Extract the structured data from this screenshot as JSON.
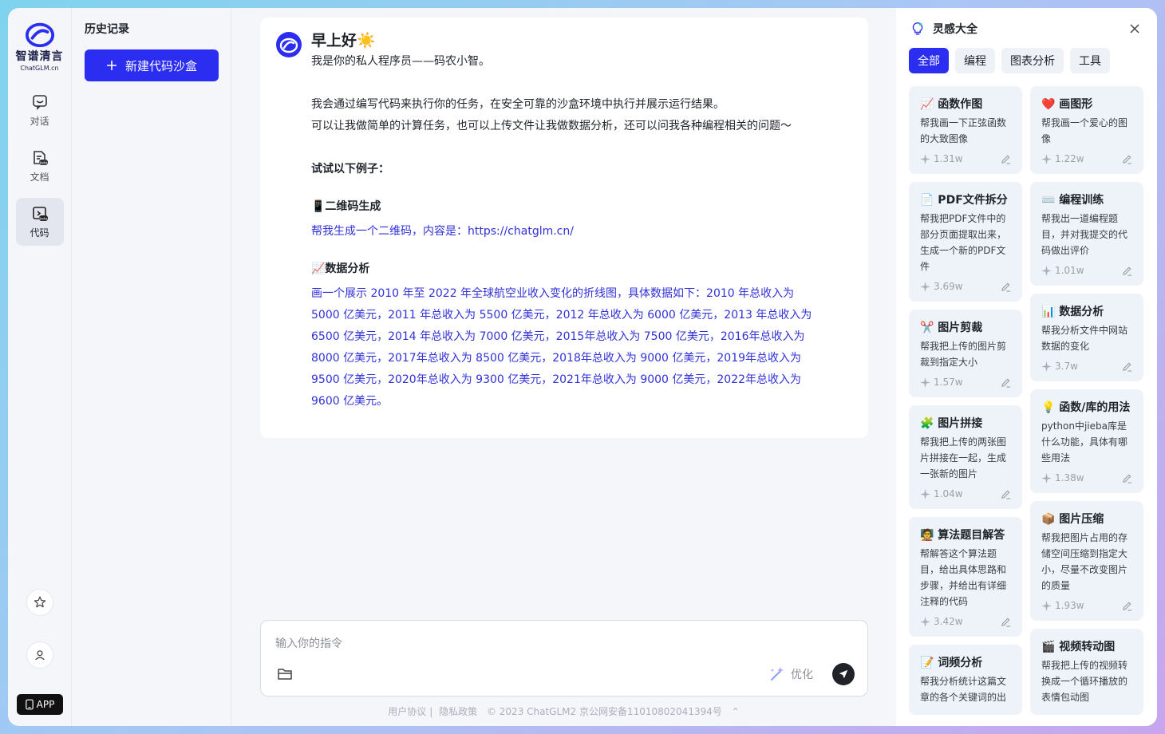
{
  "brand": {
    "name_cn": "智谱清言",
    "name_en": "ChatGLM.cn"
  },
  "rail": {
    "items": [
      {
        "label": "对话",
        "icon": "chat-icon"
      },
      {
        "label": "文档",
        "icon": "document-beta-icon"
      },
      {
        "label": "代码",
        "icon": "code-beta-icon"
      }
    ],
    "app_label": "APP"
  },
  "history": {
    "title": "历史记录",
    "new_button": "新建代码沙盒"
  },
  "chat": {
    "greeting": "早上好☀️",
    "intro": "我是你的私人程序员——码农小智。",
    "line1": "我会通过编写代码来执行你的任务，在安全可靠的沙盒环境中执行并展示运行结果。",
    "line2": "可以让我做简单的计算任务，也可以上传文件让我做数据分析，还可以问我各种编程相关的问题～",
    "try_title": "试试以下例子：",
    "ex1_title": "📱二维码生成",
    "ex1_link": "帮我生成一个二维码，内容是：https://chatglm.cn/",
    "ex2_title": "📈数据分析",
    "ex2_lines": [
      "画一个展示 2010 年至 2022 年全球航空业收入变化的折线图，具体数据如下：2010 年总收入为",
      "5000 亿美元，2011 年总收入为 5500 亿美元，2012 年总收入为 6000 亿美元，2013 年总收入为",
      "6500 亿美元，2014 年总收入为 7000 亿美元，2015年总收入为 7500 亿美元，2016年总收入为",
      "8000 亿美元，2017年总收入为 8500 亿美元，2018年总收入为 9000 亿美元，2019年总收入为",
      "9500 亿美元，2020年总收入为 9300 亿美元，2021年总收入为 9000 亿美元，2022年总收入为",
      "9600 亿美元。"
    ]
  },
  "input": {
    "placeholder": "输入你的指令",
    "optimize_label": "优化"
  },
  "footer": {
    "agreement": "用户协议",
    "privacy": "隐私政策",
    "copyright": "© 2023 ChatGLM2 京公网安备11010802041394号"
  },
  "inspiration": {
    "title": "灵感大全",
    "tabs": [
      "全部",
      "编程",
      "图表分析",
      "工具"
    ],
    "left": [
      {
        "title": "📈 函数作图",
        "desc": "帮我画一下正弦函数的大致图像",
        "count": "1.31w"
      },
      {
        "title": "📄 PDF文件拆分",
        "desc": "帮我把PDF文件中的部分页面提取出来，生成一个新的PDF文件",
        "count": "3.69w"
      },
      {
        "title": "✂️ 图片剪裁",
        "desc": "帮我把上传的图片剪裁到指定大小",
        "count": "1.57w"
      },
      {
        "title": "🧩 图片拼接",
        "desc": "帮我把上传的两张图片拼接在一起，生成一张新的图片",
        "count": "1.04w"
      },
      {
        "title": "🧑‍🏫 算法题目解答",
        "desc": "帮解答这个算法题目，给出具体思路和步骤，并给出有详细注释的代码",
        "count": "3.42w"
      },
      {
        "title": "📝 词频分析",
        "desc": "帮我分析统计这篇文章的各个关键词的出",
        "count": ""
      }
    ],
    "right": [
      {
        "title": "❤️ 画图形",
        "desc": "帮我画一个爱心的图像",
        "count": "1.22w"
      },
      {
        "title": "⌨️ 编程训练",
        "desc": "帮我出一道编程题目，并对我提交的代码做出评价",
        "count": "1.01w"
      },
      {
        "title": "📊 数据分析",
        "desc": "帮我分析文件中网站数据的变化",
        "count": "3.7w"
      },
      {
        "title": "💡 函数/库的用法",
        "desc": "python中jieba库是什么功能，具体有哪些用法",
        "count": "1.38w"
      },
      {
        "title": "📦 图片压缩",
        "desc": "帮我把图片占用的存储空间压缩到指定大小，尽量不改变图片的质量",
        "count": "1.93w"
      },
      {
        "title": "🎬 视频转动图",
        "desc": "帮我把上传的视频转换成一个循环播放的表情包动图",
        "count": ""
      }
    ]
  }
}
